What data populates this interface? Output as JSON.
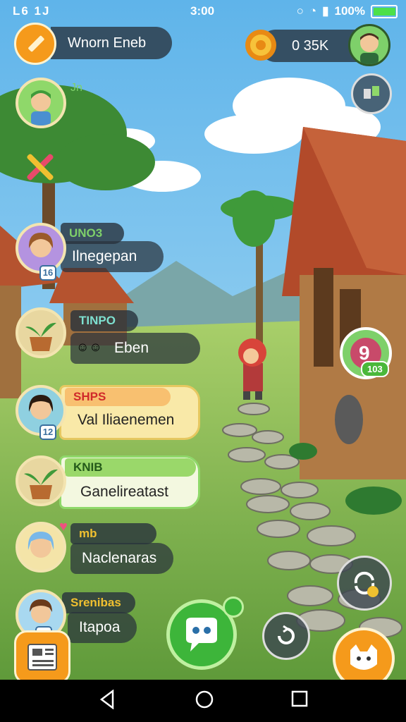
{
  "status": {
    "left": "L6 1J",
    "time": "3:00",
    "battery": "100%"
  },
  "header": {
    "player_name": "Wnorn Eneb",
    "currency": "0 35K"
  },
  "chat": [
    {
      "tag": "",
      "name": "",
      "msg": "",
      "label": "Jn"
    },
    {
      "tag": "UNO3",
      "msg": "Ilnegepan",
      "badge": "16",
      "tag_color": "#6cbf3a"
    },
    {
      "tag": "TINPO",
      "msg": "Eben",
      "tag_color": "#3fb0a8"
    },
    {
      "tag": "SHPS",
      "msg": "Val Iliaenemen",
      "badge": "12",
      "tag_color": "#e84a3c"
    },
    {
      "tag": "KNIB",
      "msg": "Ganelireatast",
      "tag_color": "#6cbf3a"
    },
    {
      "tag": "mb",
      "msg": "Naclenaras"
    },
    {
      "tag": "Srenibas",
      "msg": "Itapoa",
      "badge": "10"
    }
  ],
  "side": {
    "badge": "103"
  },
  "colors": {
    "accent": "#f59a1b",
    "chat_green": "#3db53a"
  }
}
